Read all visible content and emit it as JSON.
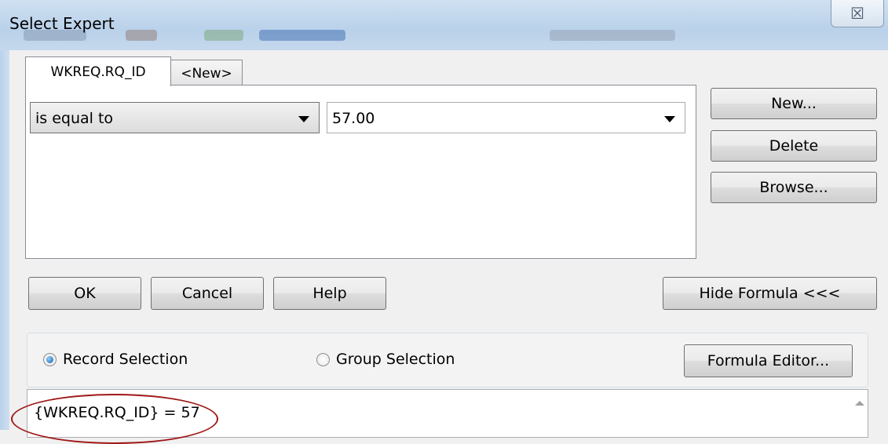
{
  "window": {
    "title": "Select Expert",
    "close_glyph": "☒"
  },
  "tabs": [
    {
      "label": "WKREQ.RQ_ID"
    },
    {
      "label": "<New>"
    }
  ],
  "condition": {
    "operator": "is equal to",
    "value": "57.00"
  },
  "side_buttons": {
    "new": "New...",
    "delete": "Delete",
    "browse": "Browse..."
  },
  "action_buttons": {
    "ok": "OK",
    "cancel": "Cancel",
    "help": "Help",
    "hide_formula": "Hide Formula <<<"
  },
  "selection": {
    "record": "Record Selection",
    "group": "Group Selection",
    "selected": "record",
    "formula_editor": "Formula Editor..."
  },
  "formula": {
    "text": "{WKREQ.RQ_ID} = 57"
  },
  "colors": {
    "annotation": "#a01818",
    "title_bar": "#b9d1ea"
  }
}
